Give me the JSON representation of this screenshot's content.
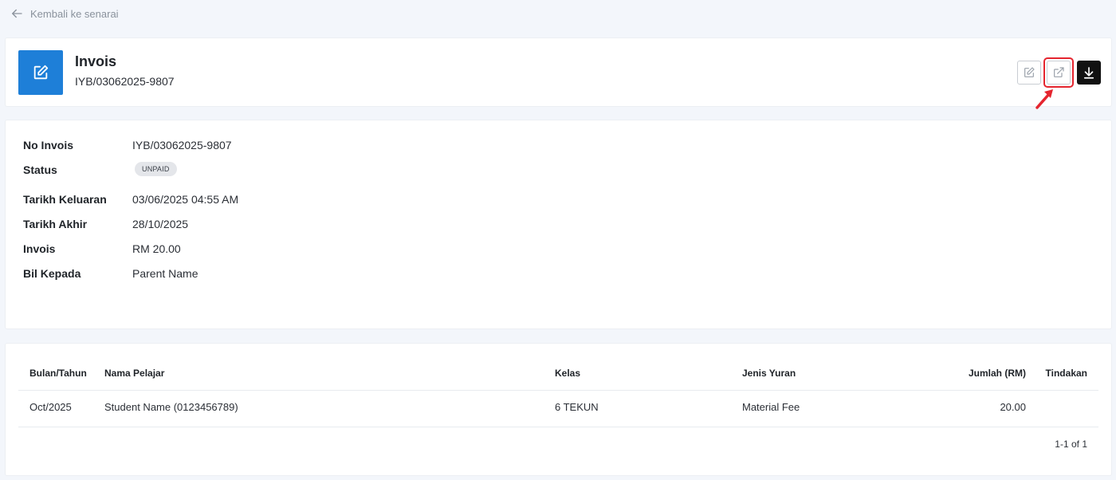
{
  "nav": {
    "back_label": "Kembali ke senarai"
  },
  "header": {
    "title": "Invois",
    "subtitle": "IYB/03062025-9807",
    "accent_color": "#1e7fd8",
    "actions": {
      "edit_icon": "edit-icon",
      "open_icon": "external-link-icon",
      "download_icon": "download-icon",
      "highlight_color": "#e5252f"
    }
  },
  "details": {
    "invoice_no": {
      "label": "No Invois",
      "value": "IYB/03062025-9807"
    },
    "status": {
      "label": "Status",
      "value": "UNPAID"
    },
    "issue_date": {
      "label": "Tarikh Keluaran",
      "value": "03/06/2025 04:55 AM"
    },
    "due_date": {
      "label": "Tarikh Akhir",
      "value": "28/10/2025"
    },
    "amount": {
      "label": "Invois",
      "value": "RM 20.00"
    },
    "bill_to": {
      "label": "Bil Kepada",
      "value": "Parent Name"
    }
  },
  "table": {
    "columns": [
      "Bulan/Tahun",
      "Nama Pelajar",
      "Kelas",
      "Jenis Yuran",
      "Jumlah (RM)",
      "Tindakan"
    ],
    "rows": [
      {
        "month": "Oct/2025",
        "student": "Student Name (0123456789)",
        "class": "6 TEKUN",
        "fee_type": "Material Fee",
        "amount": "20.00",
        "action": ""
      }
    ],
    "pagination": "1-1 of 1"
  }
}
